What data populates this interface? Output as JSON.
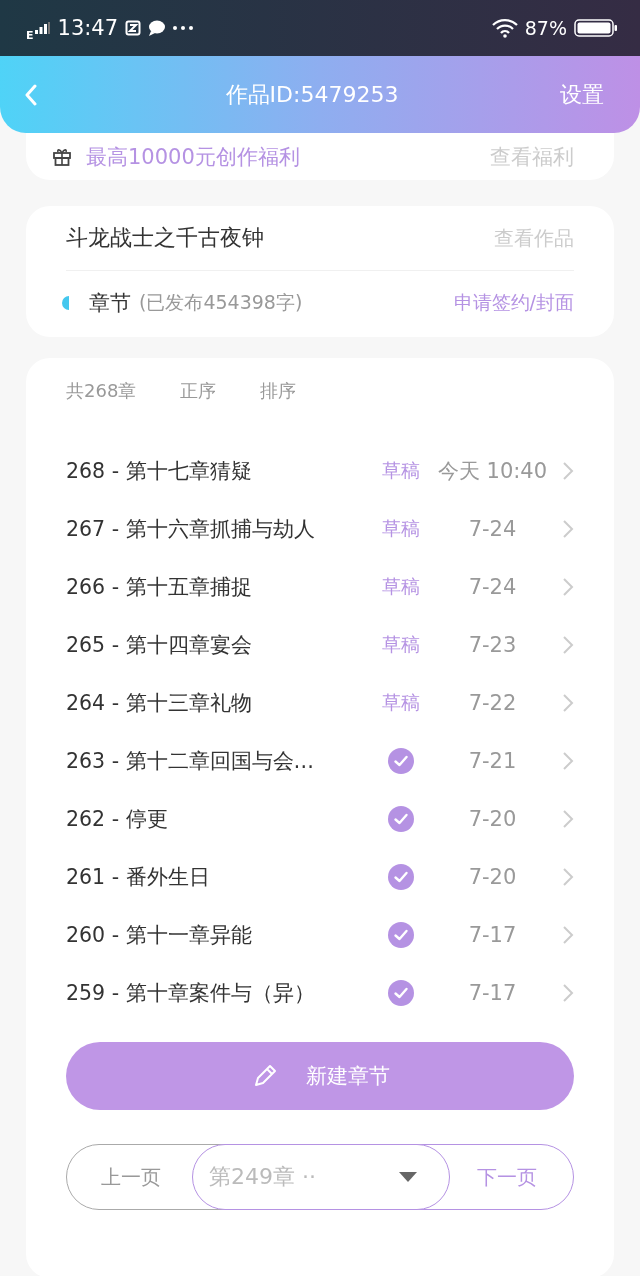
{
  "status_bar": {
    "network": "E",
    "time": "13:47",
    "battery": "87%"
  },
  "header": {
    "title": "作品ID:5479253",
    "action": "设置"
  },
  "benefit": {
    "text": "最高10000元创作福利",
    "link": "查看福利"
  },
  "work": {
    "title": "斗龙战士之千古夜钟",
    "view": "查看作品",
    "section": "章节",
    "published": "(已发布454398字)",
    "apply": "申请签约/封面"
  },
  "list_header": {
    "count": "共268章",
    "order": "正序",
    "sort": "排序"
  },
  "chapters": [
    {
      "title": "268 - 第十七章猜疑",
      "kind": "draft",
      "status": "草稿",
      "date": "今天 10:40"
    },
    {
      "title": "267 - 第十六章抓捕与劫人",
      "kind": "draft",
      "status": "草稿",
      "date": "7-24"
    },
    {
      "title": "266 - 第十五章捕捉",
      "kind": "draft",
      "status": "草稿",
      "date": "7-24"
    },
    {
      "title": "265 - 第十四章宴会",
      "kind": "draft",
      "status": "草稿",
      "date": "7-23"
    },
    {
      "title": "264 - 第十三章礼物",
      "kind": "draft",
      "status": "草稿",
      "date": "7-22"
    },
    {
      "title": "263 - 第十二章回国与会…",
      "kind": "published",
      "date": "7-21"
    },
    {
      "title": "262 - 停更",
      "kind": "published",
      "date": "7-20"
    },
    {
      "title": "261 - 番外生日",
      "kind": "published",
      "date": "7-20"
    },
    {
      "title": "260 - 第十一章异能",
      "kind": "published",
      "date": "7-17"
    },
    {
      "title": "259 - 第十章案件与（异）",
      "kind": "published",
      "date": "7-17"
    }
  ],
  "new_chapter": "新建章节",
  "pager": {
    "prev": "上一页",
    "select": "第249章 ··",
    "next": "下一页"
  }
}
